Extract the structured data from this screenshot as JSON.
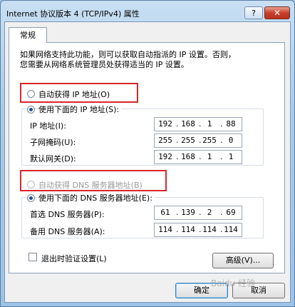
{
  "window": {
    "title": "Internet 协议版本 4 (TCP/IPv4) 属性",
    "help_label": "?",
    "close_label": "✕"
  },
  "tab": {
    "label": "常规"
  },
  "description": {
    "line1": "如果网络支持此功能，则可以获取自动指派的 IP 设置。否则，",
    "line2": "您需要从网络系统管理员处获得适当的 IP 设置。"
  },
  "ip": {
    "auto_label": "自动获得 IP 地址(O)",
    "manual_label": "使用下面的 IP 地址(S):",
    "auto_selected": false,
    "manual_selected": true,
    "fields": [
      {
        "label": "IP 地址(I):",
        "octets": [
          "192",
          "168",
          "1",
          "88"
        ]
      },
      {
        "label": "子网掩码(U):",
        "octets": [
          "255",
          "255",
          "255",
          "0"
        ]
      },
      {
        "label": "默认网关(D):",
        "octets": [
          "192",
          "168",
          "1",
          "1"
        ]
      }
    ]
  },
  "dns": {
    "auto_label": "自动获得 DNS 服务器地址(B)",
    "manual_label": "使用下面的 DNS 服务器地址(E):",
    "auto_enabled": false,
    "manual_selected": true,
    "fields": [
      {
        "label": "首选 DNS 服务器(P):",
        "octets": [
          "61",
          "139",
          "2",
          "69"
        ]
      },
      {
        "label": "备用 DNS 服务器(A):",
        "octets": [
          "114",
          "114",
          "114",
          "114"
        ]
      }
    ]
  },
  "validate": {
    "label": "退出时验证设置(L)",
    "checked": false
  },
  "buttons": {
    "advanced": "高级(V)...",
    "ok": "确定",
    "cancel": "取消"
  },
  "watermark": "Baidu 经验"
}
